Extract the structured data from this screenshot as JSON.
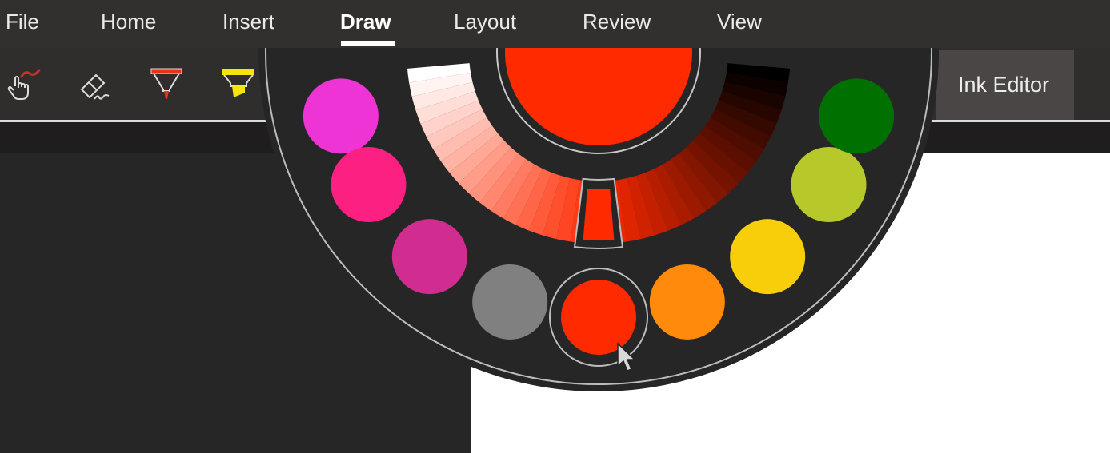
{
  "menu": {
    "tabs": [
      {
        "label": "File"
      },
      {
        "label": "Home"
      },
      {
        "label": "Insert"
      },
      {
        "label": "Draw",
        "active": true
      },
      {
        "label": "Layout"
      },
      {
        "label": "Review"
      },
      {
        "label": "View"
      }
    ]
  },
  "toolbar": {
    "tools": [
      {
        "name": "touch-drawing",
        "icon": "hand-ink-icon"
      },
      {
        "name": "eraser",
        "icon": "eraser-icon"
      },
      {
        "name": "red-pen",
        "icon": "pen-icon",
        "color": "#e8321e"
      },
      {
        "name": "yellow-highlighter",
        "icon": "highlighter-icon",
        "color": "#f5e50c"
      }
    ],
    "ink_editor_label": "Ink Editor"
  },
  "color_wheel": {
    "selected_color": "#ff2a00",
    "swatches": [
      {
        "name": "magenta",
        "color": "#ee34d5"
      },
      {
        "name": "hot-pink",
        "color": "#fb2082"
      },
      {
        "name": "orchid",
        "color": "#d12c90"
      },
      {
        "name": "gray",
        "color": "#808080"
      },
      {
        "name": "red",
        "color": "#ff2a00",
        "selected": true
      },
      {
        "name": "orange",
        "color": "#ff8a0c"
      },
      {
        "name": "yellow",
        "color": "#f8ce0b"
      },
      {
        "name": "yellow-green",
        "color": "#b6c82a"
      },
      {
        "name": "green",
        "color": "#007000"
      }
    ],
    "shade_light_end": "#ffffff",
    "shade_dark_end": "#000000"
  }
}
